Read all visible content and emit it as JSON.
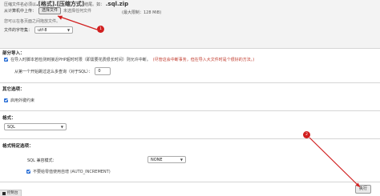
{
  "upload": {
    "hint_prefix": "压缩文件名必须以",
    "hint_ext": ".[格式].[压缩方式]",
    "hint_suffix": "结尾。如：",
    "hint_example": ".sql.zip",
    "label": "从计算机中上传：",
    "choose_button": "选择文件",
    "no_file": "未选择任何文件",
    "max_size": "(最大限制：128 MiB)",
    "hint_drag": "您可以在各页面之间拖放文件。",
    "charset_label": "文件的字符集：",
    "charset_value": "utf-8"
  },
  "partial": {
    "title": "部分导入：",
    "allow_interrupt": "在导入时脚本若检测到接近PHP超时时限（即需要花费很长时间）则允许中断。",
    "allow_interrupt_warn": "(尽管这会中断事务，但在导入大文件时是个很好的方法。)",
    "skip_label": "从第一个开始跳过这么多查询（对于SQL）：",
    "skip_value": "0"
  },
  "other": {
    "title": "其它选项：",
    "foreign_key_label": "启用外键约束"
  },
  "format": {
    "title": "格式：",
    "value": "SQL"
  },
  "format_specific": {
    "title": "格式特定选项：",
    "compat_label": "SQL 兼容模式：",
    "compat_value": "NONE",
    "auto_increment_label": "不要给零值使用自增 (AUTO_INCREMENT)"
  },
  "actions": {
    "go_button": "执行"
  },
  "console": {
    "label": "控制台"
  },
  "annotations": {
    "marker_1": "1",
    "marker_2": "2"
  },
  "colors": {
    "marker": "#d11f1f",
    "checkbox": "#2a6fd6"
  }
}
